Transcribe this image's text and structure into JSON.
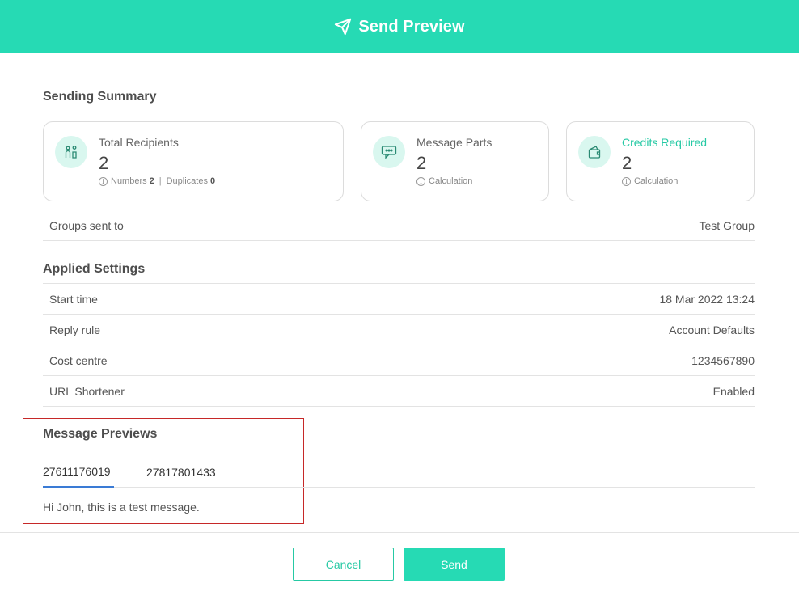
{
  "header": {
    "title": "Send Preview",
    "icon": "paper-plane-icon"
  },
  "summary": {
    "title": "Sending Summary",
    "cards": [
      {
        "icon": "recipients-icon",
        "label": "Total Recipients",
        "value": "2",
        "numbers_label": "Numbers",
        "numbers_value": "2",
        "duplicates_label": "Duplicates",
        "duplicates_value": "0"
      },
      {
        "icon": "message-parts-icon",
        "label": "Message Parts",
        "value": "2",
        "sub": "Calculation"
      },
      {
        "icon": "wallet-icon",
        "label": "Credits Required",
        "value": "2",
        "sub": "Calculation"
      }
    ],
    "accent": "#26c9a4"
  },
  "groups": {
    "label": "Groups sent to",
    "value": "Test Group"
  },
  "settings": {
    "title": "Applied Settings",
    "rows": [
      {
        "label": "Start time",
        "value": "18 Mar 2022 13:24"
      },
      {
        "label": "Reply rule",
        "value": "Account Defaults"
      },
      {
        "label": "Cost centre",
        "value": "1234567890"
      },
      {
        "label": "URL Shortener",
        "value": "Enabled"
      }
    ]
  },
  "previews": {
    "title": "Message Previews",
    "tabs": [
      "27611176019",
      "27817801433"
    ],
    "active_tab": "27611176019",
    "message": "Hi John, this is a test message."
  },
  "footer": {
    "cancel_label": "Cancel",
    "send_label": "Send"
  },
  "colors": {
    "brand": "#26dab4",
    "active_tab": "#3a7bd5",
    "highlight_border": "#c62828"
  }
}
